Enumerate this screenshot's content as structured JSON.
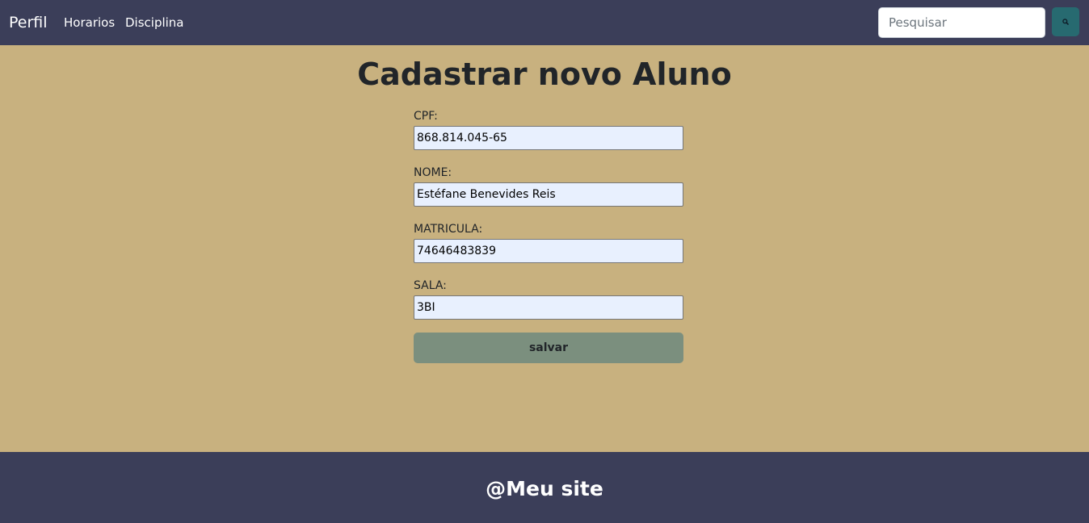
{
  "navbar": {
    "brand": "Perfil",
    "links": [
      {
        "label": "Horarios"
      },
      {
        "label": "Disciplina"
      }
    ],
    "search": {
      "placeholder": "Pesquisar",
      "button_icon": "search-icon"
    }
  },
  "main": {
    "title": "Cadastrar novo Aluno",
    "form": {
      "cpf": {
        "label": "CPF:",
        "value": "868.814.045-65"
      },
      "nome": {
        "label": "NOME:",
        "value": "Estéfane Benevides Reis"
      },
      "matricula": {
        "label": "MATRICULA:",
        "value": "74646483839"
      },
      "sala": {
        "label": "SALA:",
        "value": "3BI"
      },
      "save_label": "salvar"
    }
  },
  "footer": {
    "text": "@Meu site"
  },
  "colors": {
    "navbar": "#3b3e59",
    "page_background": "#c8b17f",
    "search_button": "#276a70",
    "save_button": "#7b8f7e",
    "input_autofill": "#e8f0fe"
  }
}
